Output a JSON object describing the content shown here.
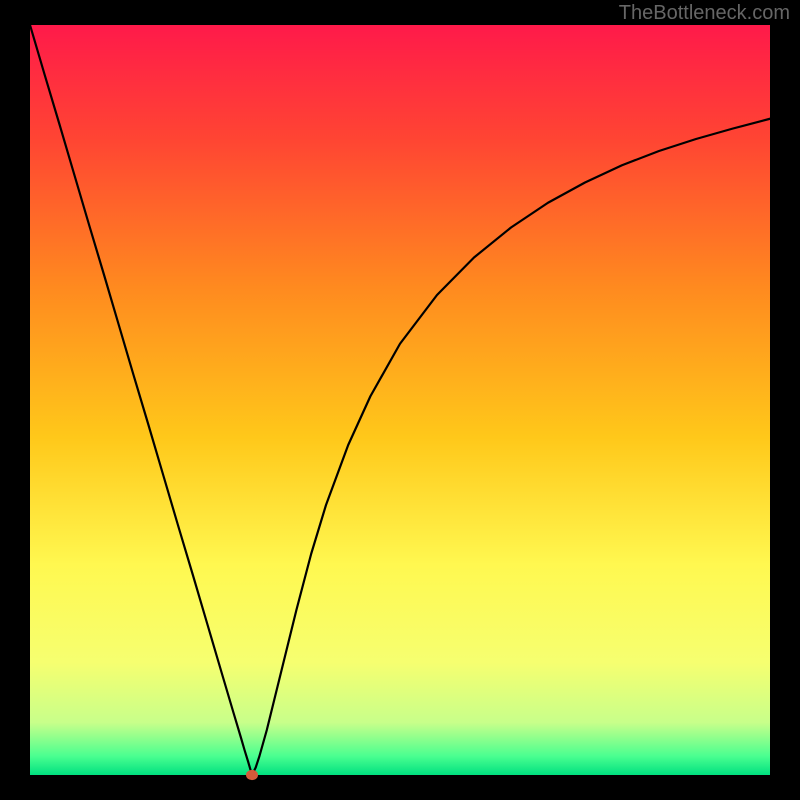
{
  "watermark": "TheBottleneck.com",
  "chart_data": {
    "type": "line",
    "title": "",
    "xlabel": "",
    "ylabel": "",
    "xlim": [
      0,
      100
    ],
    "ylim": [
      0,
      100
    ],
    "background": {
      "type": "vertical-gradient",
      "stops": [
        {
          "offset": 0.0,
          "color": "#ff1a4a"
        },
        {
          "offset": 0.15,
          "color": "#ff4433"
        },
        {
          "offset": 0.35,
          "color": "#ff8a1f"
        },
        {
          "offset": 0.55,
          "color": "#ffc81a"
        },
        {
          "offset": 0.72,
          "color": "#fff850"
        },
        {
          "offset": 0.85,
          "color": "#f6ff70"
        },
        {
          "offset": 0.93,
          "color": "#c8ff8a"
        },
        {
          "offset": 0.975,
          "color": "#4aff90"
        },
        {
          "offset": 1.0,
          "color": "#00e080"
        }
      ]
    },
    "marker": {
      "x": 30,
      "y": 0,
      "color": "#d65a3a",
      "radius_px": 6
    },
    "series": [
      {
        "name": "curve",
        "color": "#000000",
        "stroke_width_px": 2.2,
        "x": [
          0.0,
          2,
          4,
          6,
          8,
          10,
          12,
          14,
          16,
          18,
          20,
          22,
          24,
          26,
          27.5,
          28.5,
          29,
          29.5,
          30,
          30.5,
          31,
          32,
          33,
          34,
          36,
          38,
          40,
          43,
          46,
          50,
          55,
          60,
          65,
          70,
          75,
          80,
          85,
          90,
          95,
          100
        ],
        "y": [
          100,
          93.3,
          86.7,
          80.0,
          73.3,
          66.7,
          60.0,
          53.3,
          46.7,
          40.0,
          33.3,
          26.7,
          20.0,
          13.3,
          8.3,
          5.0,
          3.3,
          1.7,
          0.0,
          1.0,
          2.5,
          6.0,
          10.0,
          14.0,
          22.0,
          29.5,
          36.0,
          44.0,
          50.5,
          57.5,
          64.0,
          69.0,
          73.0,
          76.3,
          79.0,
          81.3,
          83.2,
          84.8,
          86.2,
          87.5
        ]
      }
    ]
  }
}
